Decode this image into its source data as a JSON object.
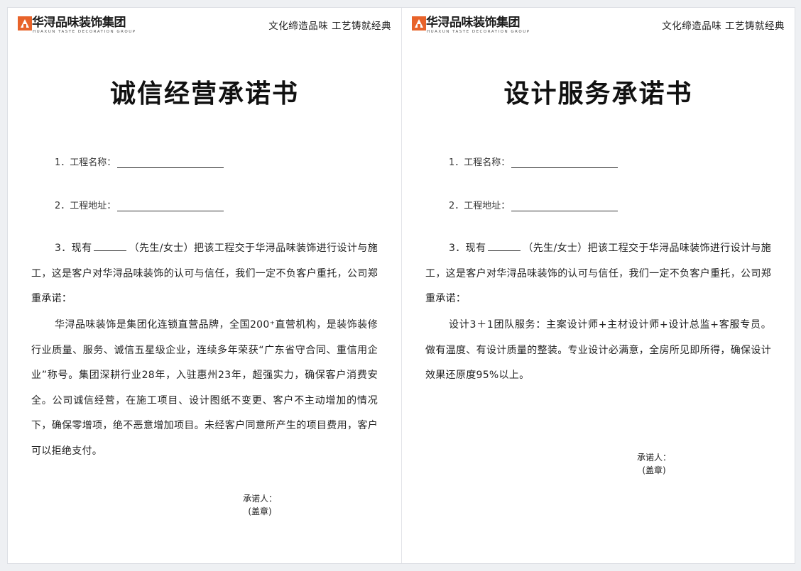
{
  "brand": {
    "logo_text": "华浔品味装饰集团",
    "logo_sub": "HUAXUN TASTE DECORATION GROUP",
    "slogan": "文化缔造品味  工艺铸就经典",
    "accent": "#e8632a"
  },
  "pages": [
    {
      "title": "诚信经营承诺书",
      "field1_label": "1．工程名称：",
      "field2_label": "2．工程地址：",
      "p3_prefix": "3．现有",
      "p3_suffix": "（先生/女士）把该工程交于华浔品味装饰进行设计与施工，这是客户对华浔品味装饰的认可与信任，我们一定不负客户重托，公司郑重承诺：",
      "body": "华浔品味装饰是集团化连锁直营品牌，全国200⁺直营机构，是装饰装修行业质量、服务、诚信五星级企业，连续多年荣获“广东省守合同、重信用企业”称号。集团深耕行业28年，入驻惠州23年，超强实力，确保客户消费安全。公司诚信经营，在施工项目、设计图纸不变更、客户不主动增加的情况下，确保零增项，绝不恶意增加项目。未经客户同意所产生的项目费用，客户可以拒绝支付。",
      "sign_label": "承诺人：",
      "seal_label": "(盖章)"
    },
    {
      "title": "设计服务承诺书",
      "field1_label": "1．工程名称：",
      "field2_label": "2．工程地址：",
      "p3_prefix": "3．现有",
      "p3_suffix": "（先生/女士）把该工程交于华浔品味装饰进行设计与施工，这是客户对华浔品味装饰的认可与信任，我们一定不负客户重托，公司郑重承诺：",
      "body": "设计3＋1团队服务：主案设计师+主材设计师+设计总监+客服专员。做有温度、有设计质量的整装。专业设计必满意，全房所见即所得，确保设计效果还原度95%以上。",
      "sign_label": "承诺人：",
      "seal_label": "(盖章)"
    }
  ]
}
